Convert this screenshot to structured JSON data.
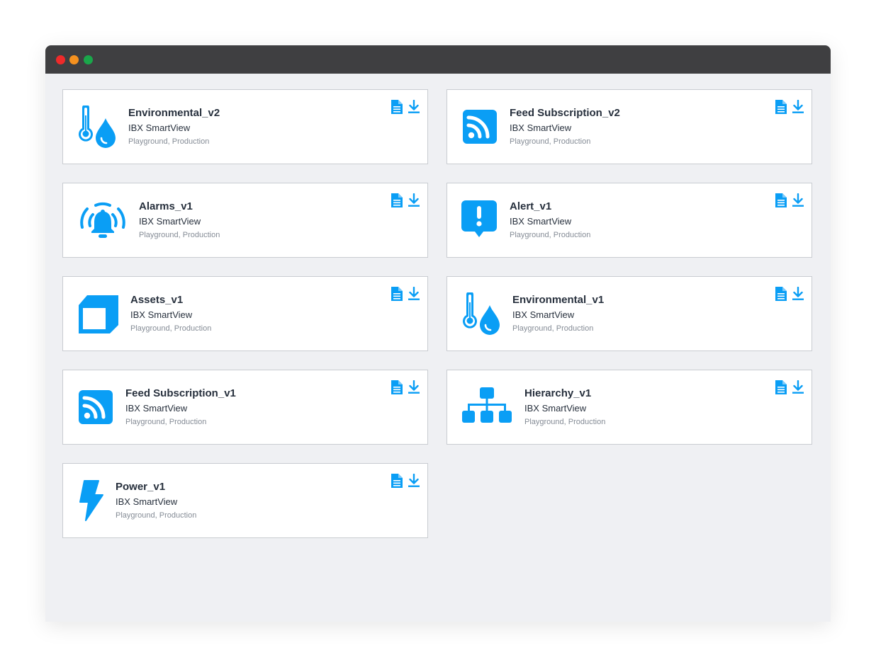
{
  "window": {
    "controls": [
      "close",
      "minimize",
      "maximize"
    ]
  },
  "colors": {
    "accent": "#0a9ef5",
    "titlebar": "#3f3f41",
    "background": "#eff0f3"
  },
  "cards": [
    {
      "name": "Environmental_v2",
      "org": "IBX SmartView",
      "envs": "Playground, Production",
      "icon": "thermometer-water-icon"
    },
    {
      "name": "Feed Subscription_v2",
      "org": "IBX SmartView",
      "envs": "Playground, Production",
      "icon": "rss-feed-icon"
    },
    {
      "name": "Alarms_v1",
      "org": "IBX SmartView",
      "envs": "Playground, Production",
      "icon": "alarm-bell-icon"
    },
    {
      "name": "Alert_v1",
      "org": "IBX SmartView",
      "envs": "Playground, Production",
      "icon": "alert-bubble-icon"
    },
    {
      "name": "Assets_v1",
      "org": "IBX SmartView",
      "envs": "Playground, Production",
      "icon": "cube-icon"
    },
    {
      "name": "Environmental_v1",
      "org": "IBX SmartView",
      "envs": "Playground, Production",
      "icon": "thermometer-water-icon"
    },
    {
      "name": "Feed Subscription_v1",
      "org": "IBX SmartView",
      "envs": "Playground, Production",
      "icon": "rss-feed-icon"
    },
    {
      "name": "Hierarchy_v1",
      "org": "IBX SmartView",
      "envs": "Playground, Production",
      "icon": "hierarchy-icon"
    },
    {
      "name": "Power_v1",
      "org": "IBX SmartView",
      "envs": "Playground, Production",
      "icon": "lightning-bolt-icon"
    }
  ]
}
